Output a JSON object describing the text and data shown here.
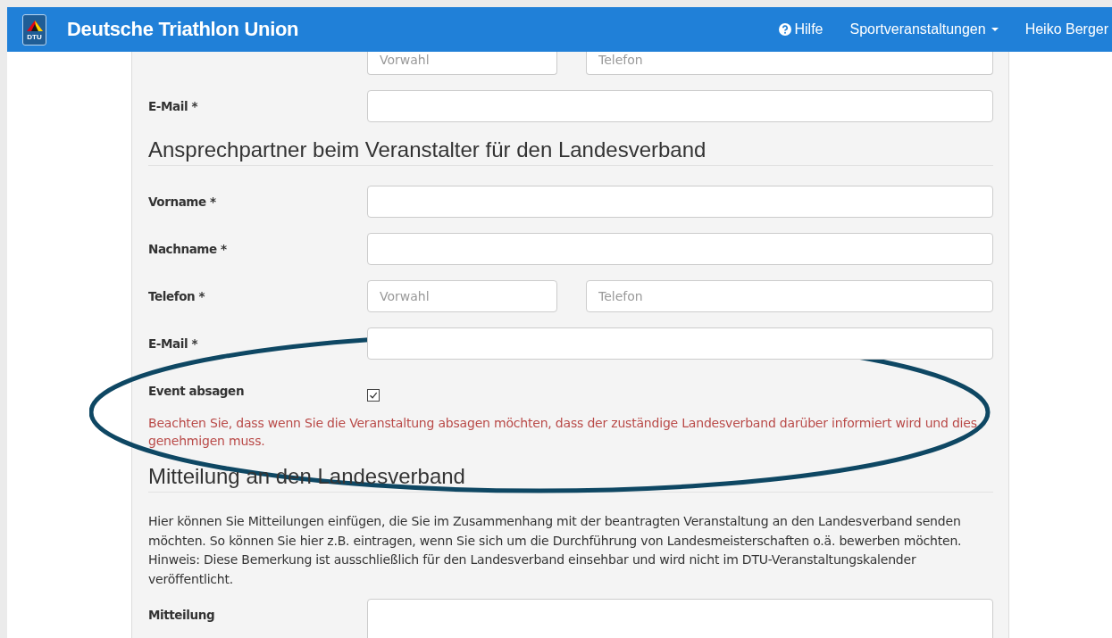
{
  "navbar": {
    "logo_text": "DTU",
    "brand": "Deutsche Triathlon Union",
    "items": [
      {
        "label": "Hilfe",
        "has_icon": true,
        "dropdown": false
      },
      {
        "label": "Sportveranstaltungen",
        "has_icon": false,
        "dropdown": true
      },
      {
        "label": "Heiko Berger",
        "has_icon": false,
        "dropdown": false
      }
    ]
  },
  "form": [
    {
      "kind": "fields",
      "fields": [
        {
          "placeholder": "Vorwahl"
        },
        {
          "placeholder": "Telefon"
        }
      ]
    },
    {
      "kind": "fields",
      "label": "E-Mail *"
    },
    {
      "kind": "heading",
      "text": "Ansprechpartner beim Veranstalter für den Landesverband"
    },
    {
      "kind": "fields",
      "label": "Vorname *"
    },
    {
      "kind": "fields",
      "label": "Nachname *"
    },
    {
      "kind": "fields",
      "label": "Telefon *",
      "fields": [
        {
          "placeholder": "Vorwahl"
        },
        {
          "placeholder": "Telefon"
        }
      ]
    },
    {
      "kind": "fields",
      "label": "E-Mail *"
    },
    {
      "kind": "checkbox",
      "label": "Event absagen",
      "checked": true
    },
    {
      "kind": "warning",
      "text": "Beachten Sie, dass wenn Sie die Veranstaltung absagen möchten, dass der zuständige Landesverband darüber informiert wird und dies genehmigen muss."
    },
    {
      "kind": "heading",
      "text": "Mitteilung an den Landesverband"
    },
    {
      "kind": "paragraph",
      "text": "Hier können Sie Mitteilungen einfügen, die Sie im Zusammenhang mit der beantragten Veranstaltung an den Landesverband senden möchten. So können Sie hier z.B. eintragen, wenn Sie sich um die Durchführung von Landesmeisterschaften o.ä. bewerben möchten. Hinweis: Diese Bemerkung ist ausschließlich für den Landesverband einsehbar und wird nicht im DTU-Veranstaltungskalender veröffentlicht."
    },
    {
      "kind": "textarea",
      "label": "Mitteilung"
    }
  ]
}
